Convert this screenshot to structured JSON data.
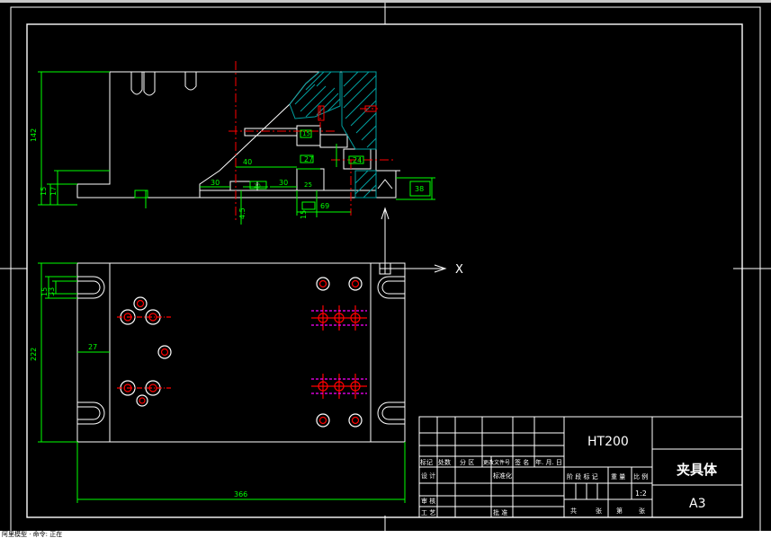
{
  "drawing": {
    "colors": {
      "background": "#000000",
      "outline": "#ffffff",
      "dimension": "#00ff00",
      "centerline": "#ff0000",
      "hatch": "#00a0a0",
      "hidden": "#ff00ff",
      "ucs": "#ffffff"
    },
    "front_view_dims": [
      "142",
      "15",
      "17",
      "40",
      "30",
      "30",
      "20",
      "27",
      "24",
      "38",
      "4.5",
      "15",
      "69",
      "15",
      "25"
    ],
    "plan_view_dims": [
      "15",
      "33",
      "222",
      "27",
      "366"
    ],
    "ucs_label": "X"
  },
  "title_block": {
    "material": "HT200",
    "part_name": "夹具体",
    "sheet_size": "A3",
    "scale": "1:2",
    "row_labels": [
      "标记",
      "处数",
      "分 区",
      "更改文件号",
      "签 名",
      "年. 月. 日"
    ],
    "design_label": "设 计",
    "standardize_label": "标准化",
    "review_label": "审 核",
    "process_label": "工 艺",
    "approve_label": "批 准",
    "stage_headers": [
      "阶 段 标 记",
      "重 量",
      "比 例"
    ],
    "sheet_footer": [
      "共",
      "张",
      "第",
      "张"
    ]
  },
  "status": {
    "text": "阿里模型 · 命令: 正在"
  }
}
